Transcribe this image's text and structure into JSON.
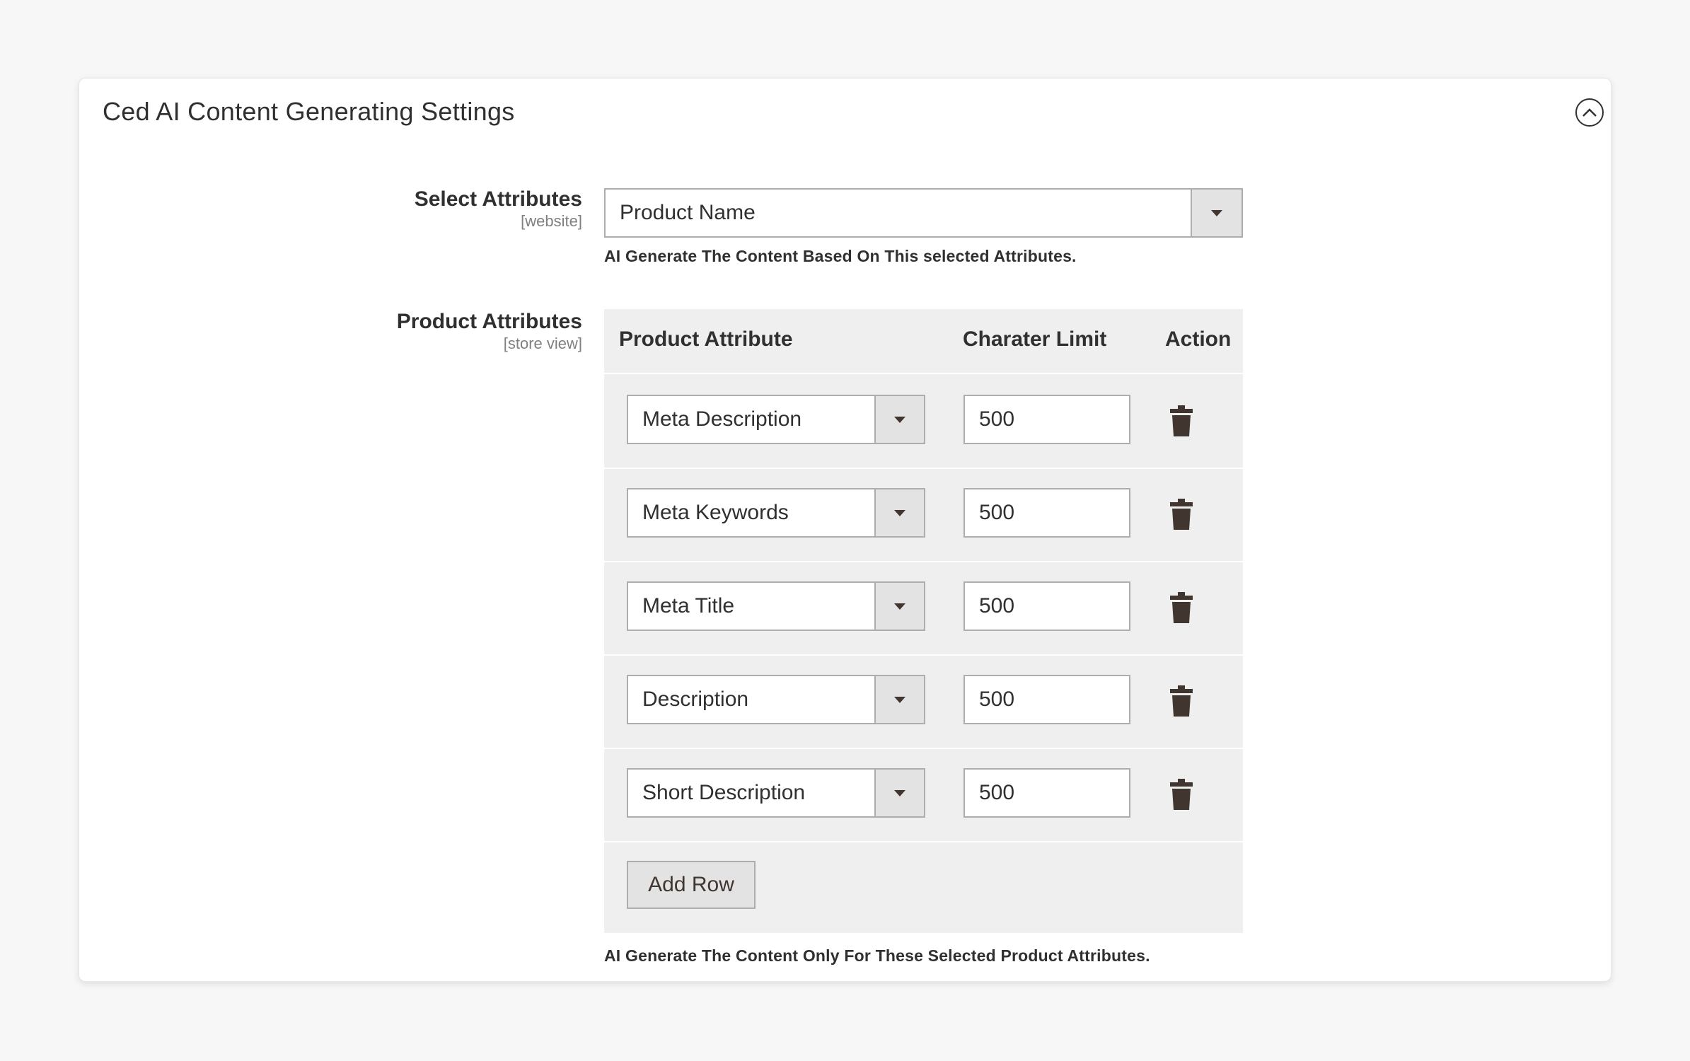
{
  "panel": {
    "title": "Ced AI Content Generating Settings"
  },
  "select_attributes": {
    "label": "Select Attributes",
    "scope": "[website]",
    "value": "Product Name",
    "note": "AI Generate The Content Based On This selected Attributes."
  },
  "product_attributes": {
    "label": "Product Attributes",
    "scope": "[store view]",
    "headers": {
      "attribute": "Product Attribute",
      "limit": "Charater Limit",
      "action": "Action"
    },
    "rows": [
      {
        "attribute": "Meta Description",
        "limit": "500"
      },
      {
        "attribute": "Meta Keywords",
        "limit": "500"
      },
      {
        "attribute": "Meta Title",
        "limit": "500"
      },
      {
        "attribute": "Description",
        "limit": "500"
      },
      {
        "attribute": "Short Description",
        "limit": "500"
      }
    ],
    "add_row_label": "Add Row",
    "note": "AI Generate The Content Only For These Selected Product Attributes."
  },
  "icons": {
    "collapse": "chevron-up-circle-icon",
    "dropdown": "triangle-down-icon",
    "delete": "trash-icon"
  }
}
